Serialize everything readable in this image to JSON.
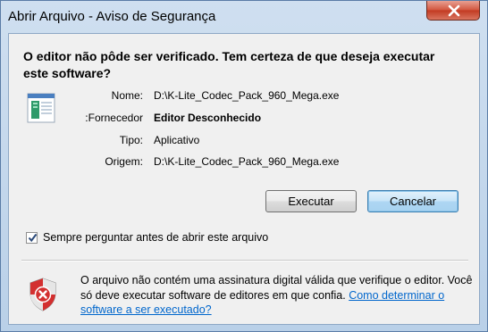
{
  "window": {
    "title": "Abrir Arquivo - Aviso de Segurança"
  },
  "dialog": {
    "heading": "O editor não pôde ser verificado. Tem certeza de que deseja executar este software?",
    "fields": {
      "name_label": "Nome:",
      "name_value": "D:\\K-Lite_Codec_Pack_960_Mega.exe",
      "publisher_label": "Fornecedor:",
      "publisher_value": "Editor Desconhecido",
      "type_label": "Tipo:",
      "type_value": "Aplicativo",
      "origin_label": "Origem:",
      "origin_value": "D:\\K-Lite_Codec_Pack_960_Mega.exe"
    },
    "buttons": {
      "run": "Executar",
      "cancel": "Cancelar"
    },
    "checkbox": {
      "label": "Sempre perguntar antes de abrir este arquivo",
      "checked": true
    },
    "warning": {
      "text": "O arquivo não contém uma assinatura digital válida que verifique o editor. Você só deve executar software de editores em que confia.",
      "link": "Como determinar o software a ser executado?"
    }
  },
  "icons": {
    "close": "close-icon",
    "file": "application-file-icon",
    "shield": "security-shield-warning-icon",
    "check": "checkmark-icon"
  },
  "colors": {
    "link": "#0066cc",
    "close_button": "#c23a22",
    "default_button_border": "#3c7fb1"
  }
}
